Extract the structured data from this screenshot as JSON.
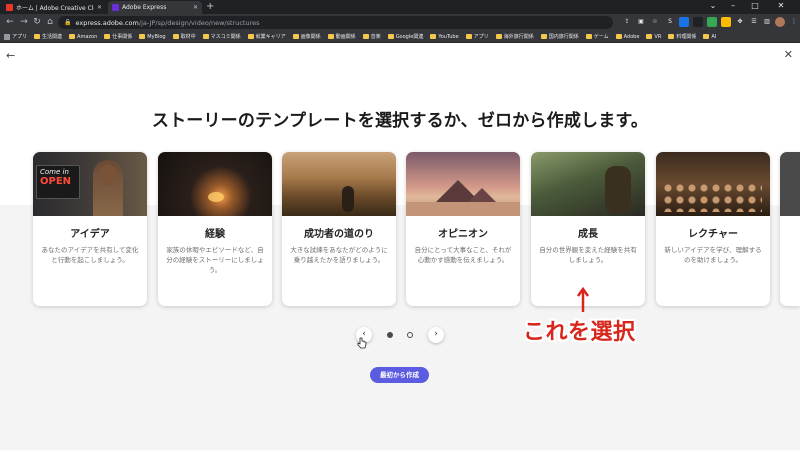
{
  "browser": {
    "tabs": [
      {
        "label": "ホーム | Adobe Creative Cloud",
        "active": false,
        "icon_color": "#e8362b"
      },
      {
        "label": "Adobe Express",
        "active": true,
        "icon_color": "#6b2fd6"
      }
    ],
    "url_host": "express.adobe.com",
    "url_path": "/ja-JP/sp/design/video/new/structures",
    "bookmarks": [
      "アプリ",
      "生活関連",
      "Amazon",
      "仕事関係",
      "MyBlog",
      "取材中",
      "マスコミ関係",
      "就業キャリア",
      "画像関係",
      "動画関係",
      "音楽",
      "Google関連",
      "YouTube",
      "アプリ",
      "海外旅行関係",
      "国内旅行関係",
      "ゲーム",
      "Adobe",
      "VR",
      "料理関係",
      "AI"
    ]
  },
  "page": {
    "headline": "ストーリーのテンプレートを選択するか、ゼロから作成します。",
    "cards": [
      {
        "title": "アイデア",
        "desc": "あなたのアイデアを共有して変化と行動を起こしましょう。",
        "sign_line1": "Come in",
        "sign_line2": "OPEN"
      },
      {
        "title": "経験",
        "desc": "家族の休暇やエピソードなど、自分の経験をストーリーにしましょう。"
      },
      {
        "title": "成功者の道のり",
        "desc": "大きな試練をあなたがどのように乗り越えたかを語りましょう。"
      },
      {
        "title": "オピニオン",
        "desc": "自分にとって大事なこと、それが心動かす感動を伝えましょう。"
      },
      {
        "title": "成長",
        "desc": "自分の世界観を変えた経験を共有しましょう。"
      },
      {
        "title": "レクチャー",
        "desc": "新しいアイデアを学び、理解するのを助けましょう。"
      }
    ],
    "prev_label": "‹",
    "next_label": "›",
    "create_button": "最初から作成"
  },
  "annotation": {
    "text": "これを選択",
    "color": "#d8261c"
  },
  "colors": {
    "accent": "#5c5ce0",
    "annotation": "#d8261c"
  }
}
